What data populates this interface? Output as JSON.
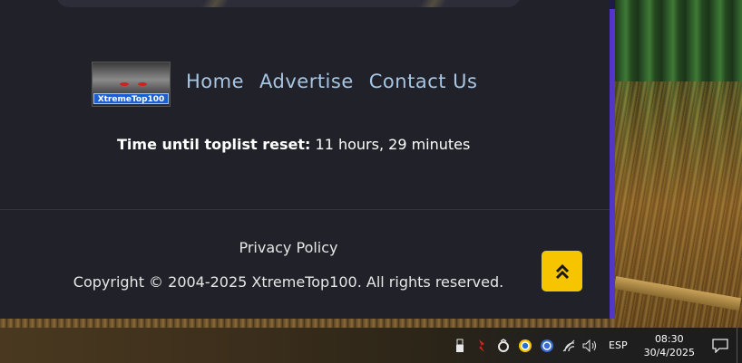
{
  "nav": {
    "logo_text": "XtremeTop100",
    "items": [
      {
        "label": "Home"
      },
      {
        "label": "Advertise"
      },
      {
        "label": "Contact Us"
      }
    ]
  },
  "reset": {
    "label": "Time until toplist reset:",
    "value": "11 hours, 29 minutes"
  },
  "footer": {
    "privacy": "Privacy Policy",
    "copyright": "Copyright © 2004-2025 XtremeTop100. All rights reserved."
  },
  "colors": {
    "panel": "#212129",
    "accent": "#f7c500",
    "nav_link": "#a7c6e3",
    "purple_bar": "#5335c8"
  },
  "taskbar": {
    "tray_icons": [
      "usb-icon",
      "red-app-icon",
      "sync-icon",
      "chrome-icon",
      "browser-icon",
      "wifi-icon",
      "volume-icon"
    ],
    "language": "ESP",
    "time": "08:30",
    "date": "30/4/2025"
  }
}
